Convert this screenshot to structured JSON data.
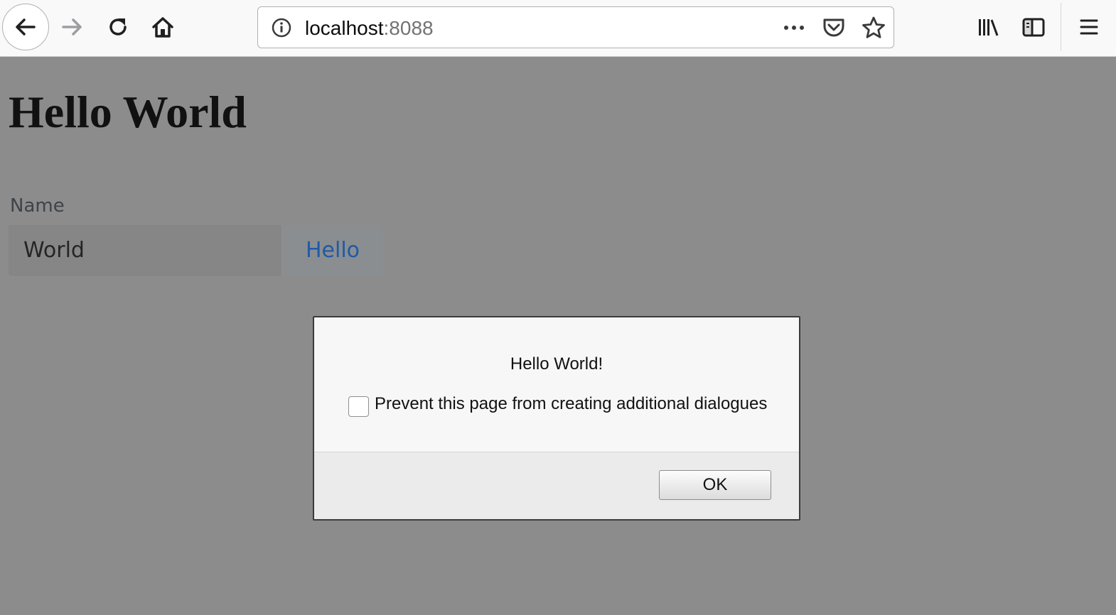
{
  "browser": {
    "url_host": "localhost",
    "url_port": ":8088",
    "icons": [
      "back-arrow-icon",
      "forward-arrow-icon",
      "reload-icon",
      "home-icon",
      "info-icon",
      "more-dots-icon",
      "pocket-icon",
      "star-icon",
      "library-icon",
      "sidebar-icon",
      "hamburger-menu-icon"
    ]
  },
  "page": {
    "heading": "Hello World",
    "name_label": "Name",
    "name_value": "World",
    "hello_button": "Hello"
  },
  "dialog": {
    "message": "Hello World!",
    "checkbox_label": "Prevent this page from creating additional dialogues",
    "checkbox_checked": false,
    "ok_button": "OK"
  },
  "colors": {
    "overlay": "#8c8c8c",
    "link_blue": "#1f5aa6",
    "toolbar_bg": "#f9f9fa"
  }
}
